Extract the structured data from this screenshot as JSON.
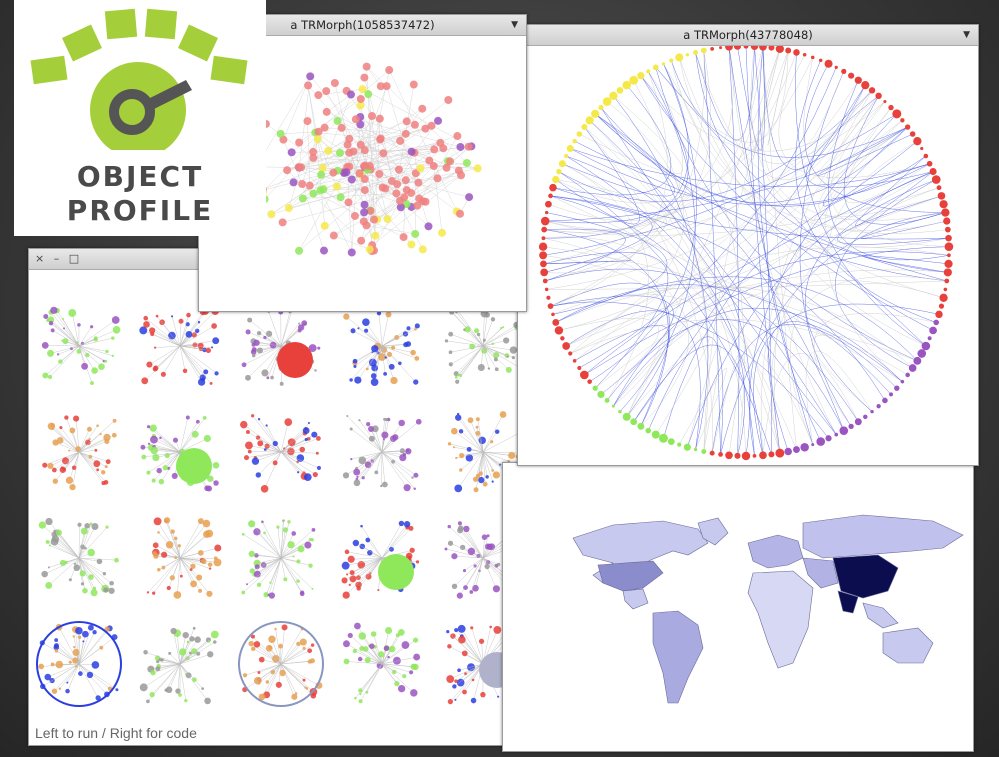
{
  "windows": {
    "left_browser": {
      "controls": "× – □",
      "status": "Left to run / Right for code"
    },
    "graph_window": {
      "title": "a TRMorph(1058537472)"
    },
    "radial_window": {
      "title": "a TRMorph(43778048)"
    }
  },
  "logo": {
    "line1": "OBJECT",
    "line2": "PROFILE",
    "colors": {
      "green": "#a5cf3a",
      "gray": "#4a4a4a"
    }
  },
  "thumbnails": [
    "force-layout",
    "tree-horizontal",
    "bubble-branch",
    "tree-wide",
    "dot-grid",
    "circle-dots",
    "green-bubbles",
    "radial-purple",
    "radial-lines",
    "radial-blue",
    "tree-gray",
    "tree-green",
    "purple-grid",
    "green-network",
    "mixed-network",
    "blue-circle-bundle",
    "heat-grid",
    "gray-circle-bundle",
    "traffic-grid",
    "single-bubble"
  ],
  "colors": {
    "red": "#e8403a",
    "pink": "#f08080",
    "yellow": "#f5e94a",
    "green": "#8ee85a",
    "purple": "#9a55c0",
    "blue": "#2b3ee0",
    "china": "#0b0d4e"
  }
}
